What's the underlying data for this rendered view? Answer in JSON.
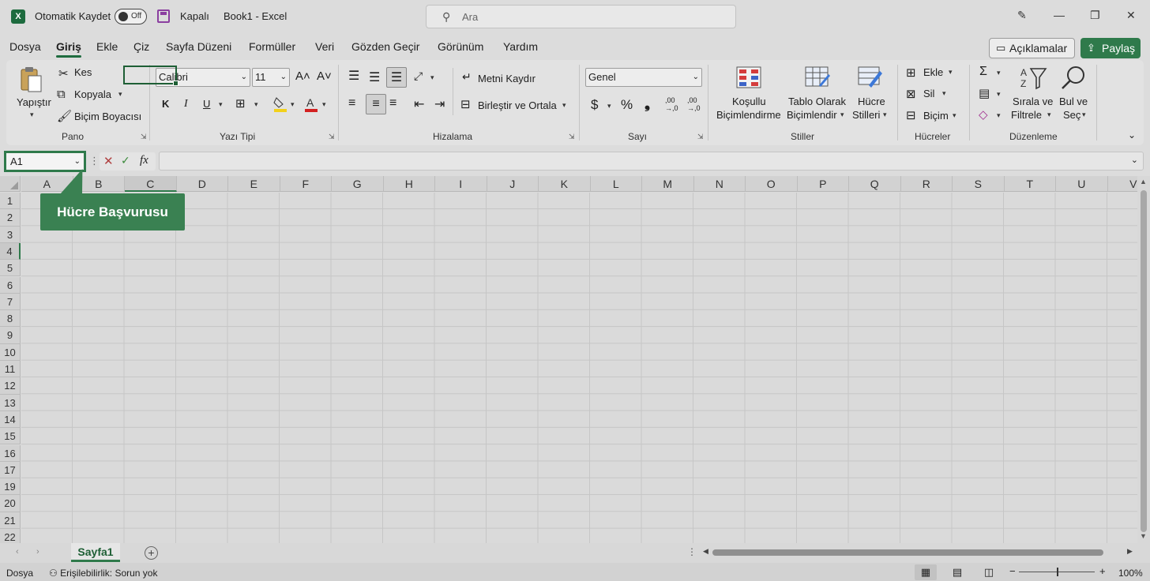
{
  "titlebar": {
    "app_icon": "excel-logo-icon",
    "autosave_label": "Otomatik Kaydet",
    "autosave_state": "Off",
    "save_status": "Kapalı",
    "title": "Book1  -  Excel",
    "search_placeholder": "Ara"
  },
  "menu": {
    "tabs": [
      "Dosya",
      "Giriş",
      "Ekle",
      "Çiz",
      "Sayfa Düzeni",
      "Formüller",
      "Veri",
      "Gözden Geçir",
      "Görünüm",
      "Yardım"
    ],
    "active_index": 1,
    "comments_label": "Açıklamalar",
    "share_label": "Paylaş"
  },
  "ribbon": {
    "pano": {
      "label": "Pano",
      "paste": "Yapıştır",
      "cut": "Kes",
      "copy": "Kopyala",
      "format_painter": "Biçim Boyacısı"
    },
    "font": {
      "label": "Yazı Tipi",
      "font_name": "Calibri",
      "font_size": "11",
      "bold": "K",
      "italic": "I",
      "underline": "U"
    },
    "alignment": {
      "label": "Hizalama",
      "wrap_text": "Metni Kaydır",
      "merge_center": "Birleştir ve Ortala"
    },
    "number": {
      "label": "Sayı",
      "format": "Genel",
      "currency": "$",
      "percent": "%",
      "comma": "❟",
      "inc_decimal": ",00",
      "inc_decimal2": "→,0",
      "dec_decimal": ",00",
      "dec_decimal2": "→,0"
    },
    "styles": {
      "label": "Stiller",
      "conditional_1": "Koşullu",
      "conditional_2": "Biçimlendirme",
      "table_1": "Tablo Olarak",
      "table_2": "Biçimlendir",
      "cell_styles_1": "Hücre",
      "cell_styles_2": "Stilleri"
    },
    "cells": {
      "label": "Hücreler",
      "insert": "Ekle",
      "delete": "Sil",
      "format": "Biçim"
    },
    "editing": {
      "label": "Düzenleme",
      "sort_1": "Sırala ve",
      "sort_2": "Filtrele",
      "find_1": "Bul ve",
      "find_2": "Seç"
    }
  },
  "formula_bar": {
    "name_box": "A1",
    "fx": "fx",
    "value": ""
  },
  "grid": {
    "columns": [
      "A",
      "B",
      "C",
      "D",
      "E",
      "F",
      "G",
      "H",
      "I",
      "J",
      "K",
      "L",
      "M",
      "N",
      "O",
      "P",
      "Q",
      "R",
      "S",
      "T",
      "U",
      "V"
    ],
    "rows": [
      "1",
      "2",
      "3",
      "4",
      "5",
      "6",
      "7",
      "8",
      "9",
      "10",
      "11",
      "12",
      "13",
      "14",
      "15",
      "16",
      "17",
      "19",
      "20",
      "21",
      "22"
    ],
    "selected_column": "C",
    "selected_row": "4"
  },
  "callout": {
    "text": "Hücre Başvurusu"
  },
  "sheets": {
    "tabs": [
      "Sayfa1"
    ],
    "add": "+"
  },
  "status": {
    "mode": "Dosya",
    "accessibility": "Erişilebilirlik: Sorun yok",
    "zoom": "100%",
    "zoom_fraction": 0.5
  }
}
